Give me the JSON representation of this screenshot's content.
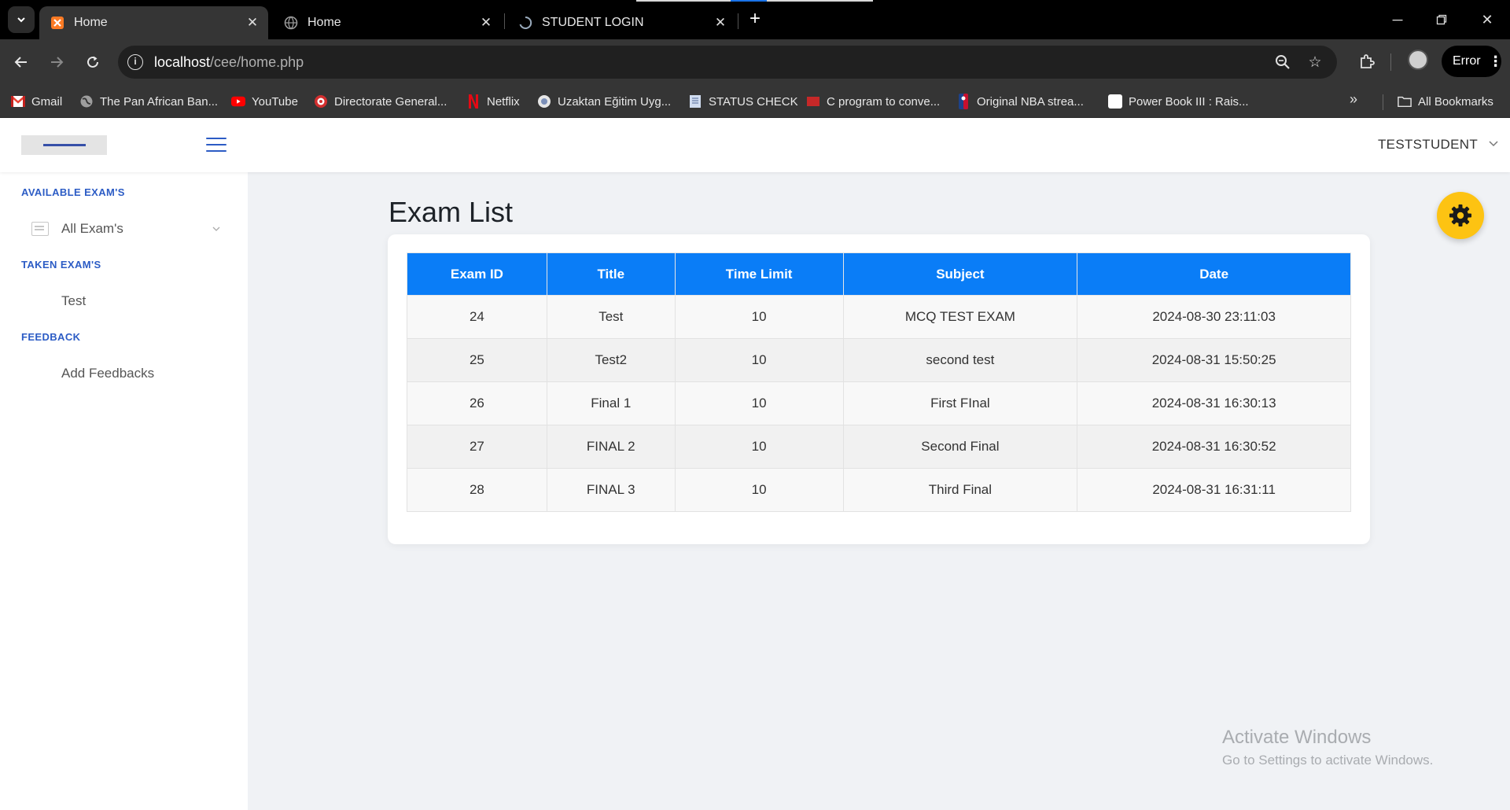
{
  "browser": {
    "tabs": [
      {
        "title": "Home",
        "favicon": "xampp-icon",
        "active": true
      },
      {
        "title": "Home",
        "favicon": "globe-icon",
        "active": false
      },
      {
        "title": "STUDENT LOGIN",
        "favicon": "spinner-icon",
        "active": false
      }
    ],
    "url_host": "localhost",
    "url_path": "/cee/home.php",
    "profile_status": "Error",
    "bookmarks": [
      {
        "label": "Gmail",
        "icon": "gmail-icon",
        "color": "#ea4335"
      },
      {
        "label": "The Pan African Ban...",
        "icon": "globe-icon",
        "color": "#9e9e9e"
      },
      {
        "label": "YouTube",
        "icon": "youtube-icon",
        "color": "#ff0000"
      },
      {
        "label": "Directorate General...",
        "icon": "seal-icon",
        "color": "#d32f2f"
      },
      {
        "label": "Netflix",
        "icon": "netflix-icon",
        "color": "#e50914"
      },
      {
        "label": "Uzaktan Eğitim Uyg...",
        "icon": "globe-icon",
        "color": "#dcdcdc"
      },
      {
        "label": "STATUS CHECK",
        "icon": "document-icon",
        "color": "#d0dcf0"
      },
      {
        "label": "C program to conve...",
        "icon": "red-square-icon",
        "color": "#c62828"
      },
      {
        "label": "Original NBA strea...",
        "icon": "nba-icon",
        "color": "#1d428a"
      },
      {
        "label": "Power Book III : Rais...",
        "icon": "white-square-icon",
        "color": "#ffffff"
      }
    ],
    "all_bookmarks_label": "All Bookmarks"
  },
  "header": {
    "username": "TESTSTUDENT"
  },
  "sidebar": {
    "sections": [
      {
        "heading": "AVAILABLE EXAM'S",
        "items": [
          {
            "label": "All Exam's",
            "icon": "list-icon",
            "has_chevron": true
          }
        ]
      },
      {
        "heading": "TAKEN EXAM'S",
        "items": [
          {
            "label": "Test"
          }
        ]
      },
      {
        "heading": "FEEDBACK",
        "items": [
          {
            "label": "Add Feedbacks"
          }
        ]
      }
    ]
  },
  "main": {
    "title": "Exam List",
    "table": {
      "columns": [
        "Exam ID",
        "Title",
        "Time Limit",
        "Subject",
        "Date"
      ],
      "rows": [
        [
          "24",
          "Test",
          "10",
          "MCQ TEST EXAM",
          "2024-08-30 23:11:03"
        ],
        [
          "25",
          "Test2",
          "10",
          "second test",
          "2024-08-31 15:50:25"
        ],
        [
          "26",
          "Final 1",
          "10",
          "First FInal",
          "2024-08-31 16:30:13"
        ],
        [
          "27",
          "FINAL 2",
          "10",
          "Second Final",
          "2024-08-31 16:30:52"
        ],
        [
          "28",
          "FINAL 3",
          "10",
          "Third Final",
          "2024-08-31 16:31:11"
        ]
      ]
    }
  },
  "watermark": {
    "line1": "Activate Windows",
    "line2": "Go to Settings to activate Windows."
  },
  "colors": {
    "accent": "#0a7df7",
    "sidebar_heading": "#2c5cc5",
    "fab": "#fdc312"
  }
}
